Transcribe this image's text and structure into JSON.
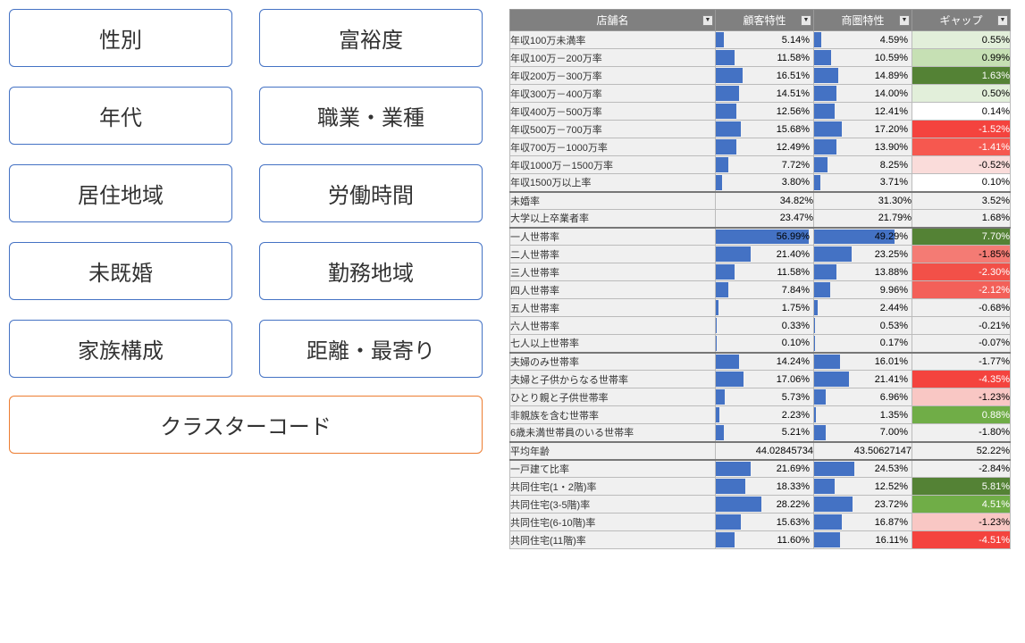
{
  "filters": {
    "row1a": "性別",
    "row1b": "富裕度",
    "row2a": "年代",
    "row2b": "職業・業種",
    "row3a": "居住地域",
    "row3b": "労働時間",
    "row4a": "未既婚",
    "row4b": "勤務地域",
    "row5a": "家族構成",
    "row5b": "距離・最寄り",
    "cluster": "クラスターコード"
  },
  "table": {
    "headers": {
      "name": "店舗名",
      "cust": "顧客特性",
      "area": "商圏特性",
      "gap": "ギャップ"
    },
    "groups": [
      [
        {
          "label": "年収100万未満率",
          "cust": 5.14,
          "area": 4.59,
          "gap": 0.55,
          "gcolor": "#E2EFDA"
        },
        {
          "label": "年収100万－200万率",
          "cust": 11.58,
          "area": 10.59,
          "gap": 0.99,
          "gcolor": "#C6E0B4"
        },
        {
          "label": "年収200万－300万率",
          "cust": 16.51,
          "area": 14.89,
          "gap": 1.63,
          "gcolor": "#548235",
          "gtext": "#fff"
        },
        {
          "label": "年収300万－400万率",
          "cust": 14.51,
          "area": 14.0,
          "gap": 0.5,
          "gcolor": "#E2EFDA"
        },
        {
          "label": "年収400万－500万率",
          "cust": 12.56,
          "area": 12.41,
          "gap": 0.14,
          "gcolor": "#FFFFFF"
        },
        {
          "label": "年収500万－700万率",
          "cust": 15.68,
          "area": 17.2,
          "gap": -1.52,
          "gcolor": "#F4433E",
          "gtext": "#fff"
        },
        {
          "label": "年収700万－1000万率",
          "cust": 12.49,
          "area": 13.9,
          "gap": -1.41,
          "gcolor": "#F6584F",
          "gtext": "#fff"
        },
        {
          "label": "年収1000万－1500万率",
          "cust": 7.72,
          "area": 8.25,
          "gap": -0.52,
          "gcolor": "#FADCDA"
        },
        {
          "label": "年収1500万以上率",
          "cust": 3.8,
          "area": 3.71,
          "gap": 0.1,
          "gcolor": "#FFFFFF"
        }
      ],
      [
        {
          "label": "未婚率",
          "cust": 34.82,
          "area": 31.3,
          "gap": 3.52,
          "gcolor": "#f0f0f0",
          "nobar": true
        },
        {
          "label": "大学以上卒業者率",
          "cust": 23.47,
          "area": 21.79,
          "gap": 1.68,
          "gcolor": "#f0f0f0",
          "nobar": true
        }
      ],
      [
        {
          "label": "一人世帯率",
          "cust": 56.99,
          "area": 49.29,
          "gap": 7.7,
          "gcolor": "#548235",
          "gtext": "#fff"
        },
        {
          "label": "二人世帯率",
          "cust": 21.4,
          "area": 23.25,
          "gap": -1.85,
          "gcolor": "#F47B74"
        },
        {
          "label": "三人世帯率",
          "cust": 11.58,
          "area": 13.88,
          "gap": -2.3,
          "gcolor": "#F25048",
          "gtext": "#fff"
        },
        {
          "label": "四人世帯率",
          "cust": 7.84,
          "area": 9.96,
          "gap": -2.12,
          "gcolor": "#F36059",
          "gtext": "#fff"
        },
        {
          "label": "五人世帯率",
          "cust": 1.75,
          "area": 2.44,
          "gap": -0.68,
          "gcolor": "#f0f0f0"
        },
        {
          "label": "六人世帯率",
          "cust": 0.33,
          "area": 0.53,
          "gap": -0.21,
          "gcolor": "#f0f0f0"
        },
        {
          "label": "七人以上世帯率",
          "cust": 0.1,
          "area": 0.17,
          "gap": -0.07,
          "gcolor": "#f0f0f0"
        }
      ],
      [
        {
          "label": "夫婦のみ世帯率",
          "cust": 14.24,
          "area": 16.01,
          "gap": -1.77,
          "gcolor": "#f0f0f0"
        },
        {
          "label": "夫婦と子供からなる世帯率",
          "cust": 17.06,
          "area": 21.41,
          "gap": -4.35,
          "gcolor": "#F4433E",
          "gtext": "#fff"
        },
        {
          "label": "ひとり親と子供世帯率",
          "cust": 5.73,
          "area": 6.96,
          "gap": -1.23,
          "gcolor": "#F9C7C4"
        },
        {
          "label": "非親族を含む世帯率",
          "cust": 2.23,
          "area": 1.35,
          "gap": 0.88,
          "gcolor": "#70AD47",
          "gtext": "#fff"
        },
        {
          "label": "6歳未満世帯員のいる世帯率",
          "cust": 5.21,
          "area": 7.0,
          "gap": -1.8,
          "gcolor": "#f0f0f0"
        }
      ],
      [
        {
          "label": "平均年齢",
          "cust_raw": "44.02845734",
          "area_raw": "43.50627147",
          "gap": 52.22,
          "gcolor": "#f0f0f0",
          "nobar": true,
          "raw": true
        }
      ],
      [
        {
          "label": "一戸建て比率",
          "cust": 21.69,
          "area": 24.53,
          "gap": -2.84,
          "gcolor": "#f0f0f0"
        },
        {
          "label": "共同住宅(1・2階)率",
          "cust": 18.33,
          "area": 12.52,
          "gap": 5.81,
          "gcolor": "#548235",
          "gtext": "#fff"
        },
        {
          "label": "共同住宅(3-5階)率",
          "cust": 28.22,
          "area": 23.72,
          "gap": 4.51,
          "gcolor": "#70AD47",
          "gtext": "#fff"
        },
        {
          "label": "共同住宅(6-10階)率",
          "cust": 15.63,
          "area": 16.87,
          "gap": -1.23,
          "gcolor": "#F9C7C4"
        },
        {
          "label": "共同住宅(11階)率",
          "cust": 11.6,
          "area": 16.11,
          "gap": -4.51,
          "gcolor": "#F4433E",
          "gtext": "#fff"
        }
      ]
    ]
  }
}
